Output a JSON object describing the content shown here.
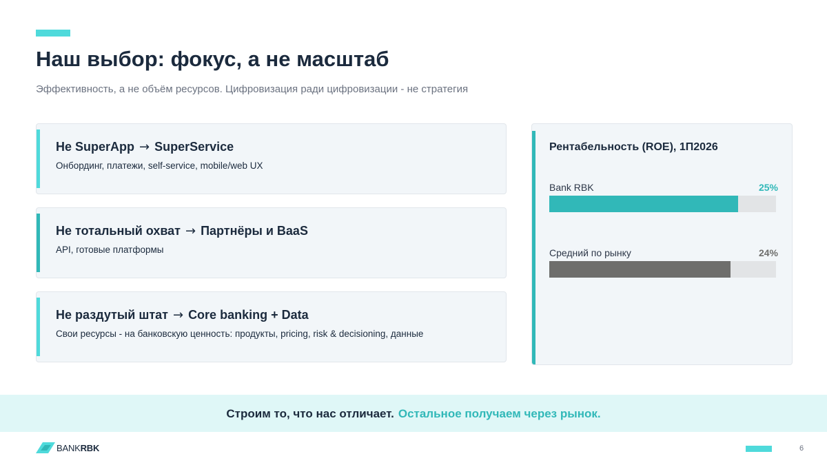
{
  "slide": {
    "title": "Наш выбор: фокус, а не масштаб",
    "subtitle": "Эффективность, а не объём ресурсов. Цифровизация ради цифровизации - не стратегия",
    "page_number": "6"
  },
  "cards": [
    {
      "from": "Не SuperApp",
      "arrow": "→",
      "to": "SuperService",
      "description": "Онбординг, платежи, self-service, mobile/web UX",
      "stripe_color": "#4fdadb"
    },
    {
      "from": "Не тотальный охват",
      "arrow": "→",
      "to": "Партнёры и BaaS",
      "description": "API, готовые платформы",
      "stripe_color": "#31b8b8"
    },
    {
      "from": "Не раздутый штат",
      "arrow": "→",
      "to": "Core banking + Data",
      "description": "Свои ресурсы - на банковскую ценность: продукты, pricing, risk & decisioning, данные",
      "stripe_color": "#4fdadb"
    }
  ],
  "roe": {
    "title": "Рентабельность (ROE), 1П2026",
    "scale_max": 30,
    "rows": [
      {
        "label": "Bank RBK",
        "value_text": "25%",
        "value": 25,
        "color": "#31b8b8",
        "value_color": "#31b8b8"
      },
      {
        "label": "Средний по рынку",
        "value_text": "24%",
        "value": 24,
        "color": "#6e6e6c",
        "value_color": "#6e6e6c"
      }
    ]
  },
  "footer_band": {
    "strong": "Строим то, что нас отличает.",
    "accent": "Остальное получаем через рынок."
  },
  "logo": {
    "bank": "BANK",
    "rbk": "RBK",
    "icon": "logo-slash-icon"
  },
  "colors": {
    "accent": "#4fdadb",
    "teal": "#31b8b8",
    "navy": "#1b2a3d",
    "band": "#dff7f7"
  }
}
